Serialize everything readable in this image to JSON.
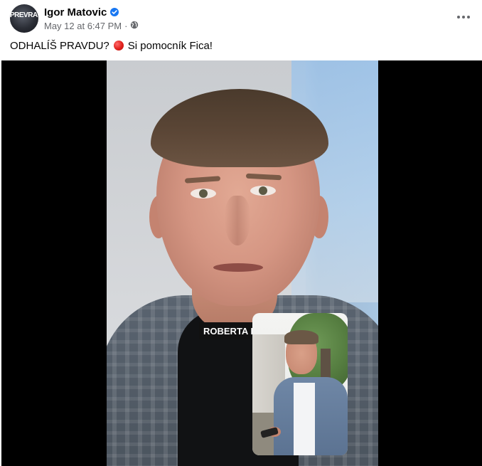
{
  "post": {
    "author": "Igor Matovic",
    "avatar_label": "PREVRAT",
    "timestamp": "May 12 at 6:47 PM",
    "separator": "·",
    "audience_icon": "globe-icon",
    "caption_before": "ODHALÍŠ PRAVDU?",
    "caption_emoji": "red-circle",
    "caption_after": "Si pomocník Fica!",
    "more_icon": "more-horizontal-icon"
  },
  "video": {
    "overlay_text": "ROBERTA I"
  },
  "colors": {
    "name": "#050505",
    "meta": "#65676b",
    "verified": "#1877f2",
    "video_bg": "#000000"
  }
}
